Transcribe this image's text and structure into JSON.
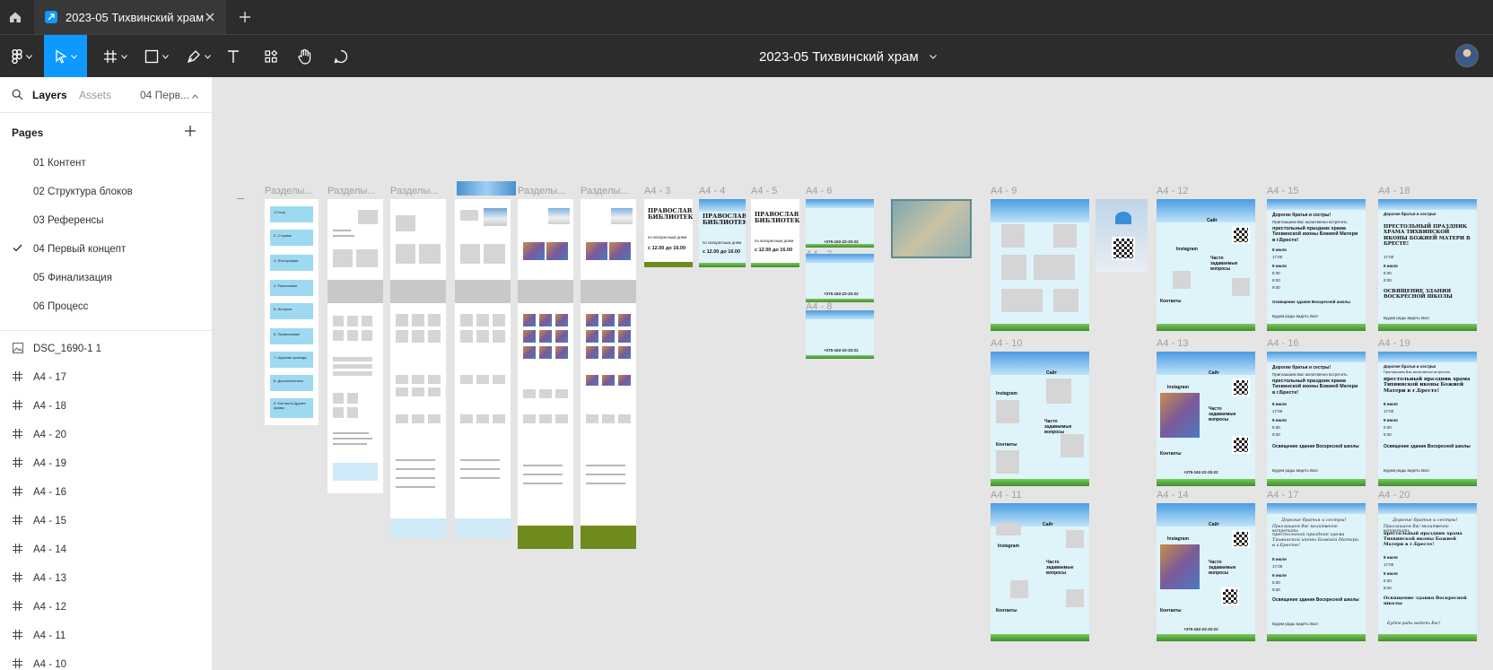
{
  "tabbar": {
    "tab_title": "2023-05 Тихвинский храм"
  },
  "toolbar": {
    "file_title": "2023-05 Тихвинский храм"
  },
  "sidebar": {
    "tabs": {
      "layers": "Layers",
      "assets": "Assets",
      "current_page": "04 Перв..."
    },
    "pages_title": "Pages",
    "pages": [
      {
        "label": "01 Контент"
      },
      {
        "label": "02 Структура блоков"
      },
      {
        "label": "03 Референсы"
      },
      {
        "label": "04 Первый концепт",
        "selected": true
      },
      {
        "label": "05 Финализация"
      },
      {
        "label": "06 Процесс"
      }
    ],
    "layers": [
      {
        "label": "DSC_1690-1 1",
        "icon": "image-icon"
      },
      {
        "label": "A4 - 17",
        "icon": "frame-icon"
      },
      {
        "label": "A4 - 18",
        "icon": "frame-icon"
      },
      {
        "label": "A4 - 20",
        "icon": "frame-icon"
      },
      {
        "label": "A4 - 19",
        "icon": "frame-icon"
      },
      {
        "label": "A4 - 16",
        "icon": "frame-icon"
      },
      {
        "label": "A4 - 15",
        "icon": "frame-icon"
      },
      {
        "label": "A4 - 14",
        "icon": "frame-icon"
      },
      {
        "label": "A4 - 13",
        "icon": "frame-icon"
      },
      {
        "label": "A4 - 12",
        "icon": "frame-icon"
      },
      {
        "label": "A4 - 11",
        "icon": "frame-icon"
      },
      {
        "label": "A4 - 10",
        "icon": "frame-icon"
      }
    ]
  },
  "canvas": {
    "labels": {
      "razd": "Разделы...",
      "a4_3": "A4 - 3",
      "a4_4": "A4 - 4",
      "a4_5": "A4 - 5",
      "a4_6": "A4 - 6",
      "a4_7": "A4 - 7",
      "a4_8": "A4 - 8",
      "a4_9": "A4 - 9",
      "a4_10": "A4 - 10",
      "a4_11": "A4 - 11",
      "a4_12": "A4 - 12",
      "a4_13": "A4 - 13",
      "a4_14": "A4 - 14",
      "a4_15": "A4 - 15",
      "a4_16": "A4 - 16",
      "a4_17": "A4 - 17",
      "a4_18": "A4 - 18",
      "a4_19": "A4 - 19",
      "a4_20": "A4 - 20"
    },
    "nav_items": [
      "1.Гость",
      "2. О храме",
      "3. Фотографии",
      "4. Расписание",
      "5. История",
      "6. Православие",
      "7. Церковь прихода",
      "8. Дополнительно",
      "9. Контакты Другие храмы"
    ],
    "library": {
      "title": "ПРАВОСЛАВНАЯ БИБЛИОТЕКА",
      "days": "по воскресным дням",
      "hours": "с 12.00 до 16.00"
    },
    "phone": "+375-162-22-33-22",
    "contacts": {
      "site": "Сайт",
      "instagram": "Instagram",
      "contacts": "Контакты",
      "faq": "Часто задаваемые вопросы"
    },
    "poster": {
      "greeting": "Дорогие братья и сестры!",
      "invite": "Приглашаем Вас молитвенно встретить",
      "feast": "престольный праздник храма Тихвинской иконы Божией Матери в г.Бресте!",
      "feast_caps": "ПРЕСТОЛЬНЫЙ ПРАЗДНИК ХРАМА ТИХВИНСКОЙ ИКОНЫ БОЖИЕЙ МАТЕРИ В БРЕСТЕ!",
      "consecration": "Освящение здания Воскресной школы",
      "consecration_caps": "ОСВЯЩЕНИЕ ЗДАНИЯ ВОСКРЕСНОЙ ШКОЛЫ",
      "ending": "Будем рады видеть Вас!",
      "date1": "8 июля",
      "date2": "9 июля",
      "t1": "17:00",
      "t2": "6:30",
      "t3": "8:20",
      "t4": "9:30"
    }
  }
}
